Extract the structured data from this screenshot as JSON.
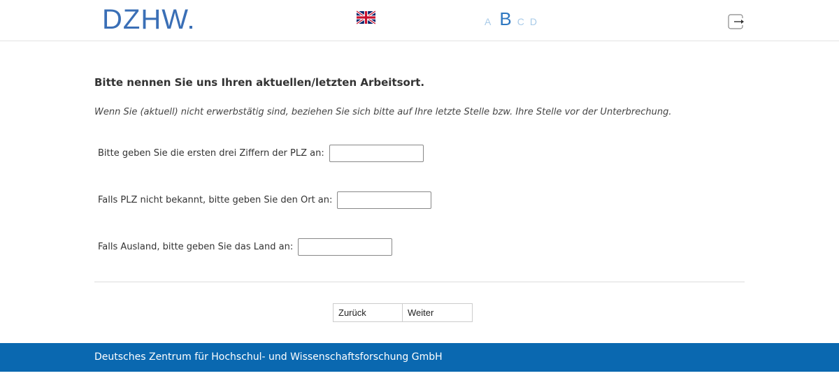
{
  "header": {
    "logo_text": "DZHW",
    "language_flag": "uk-flag-icon",
    "progress": {
      "steps": [
        "A",
        "B",
        "C",
        "D"
      ],
      "current": "B"
    },
    "logout_icon": "exit-icon"
  },
  "main": {
    "question": "Bitte nennen Sie uns Ihren aktuellen/letzten Arbeitsort.",
    "instruction": "Wenn Sie (aktuell) nicht erwerbstätig sind, beziehen Sie sich bitte auf Ihre letzte Stelle bzw. Ihre Stelle vor der Unterbrechung.",
    "fields": [
      {
        "label": "Bitte geben Sie die ersten drei Ziffern der PLZ an:",
        "value": ""
      },
      {
        "label": "Falls PLZ nicht bekannt, bitte geben Sie den Ort an:",
        "value": ""
      },
      {
        "label": "Falls Ausland, bitte geben Sie das Land an:",
        "value": ""
      }
    ]
  },
  "navigation": {
    "back_label": "Zurück",
    "next_label": "Weiter"
  },
  "footer": {
    "text": "Deutsches Zentrum für Hochschul- und Wissenschaftsforschung GmbH"
  },
  "colors": {
    "brand_blue": "#0a68b0",
    "logo_blue": "#3a6fb6",
    "progress_inactive": "#a9cbe8"
  }
}
